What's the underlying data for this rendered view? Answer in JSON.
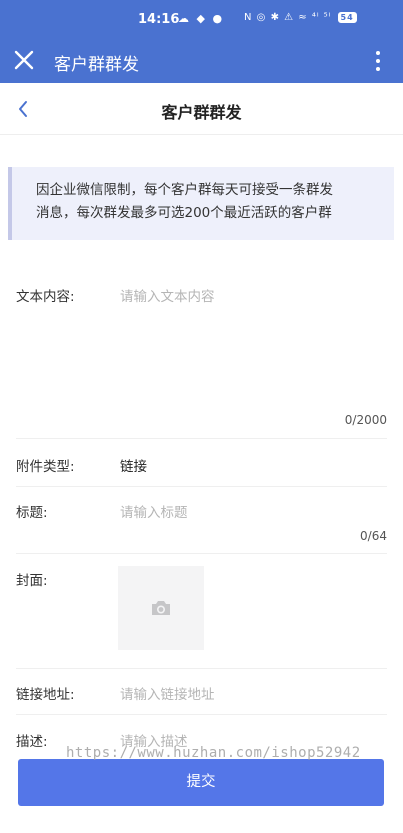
{
  "status_bar": {
    "time": "14:16",
    "left_icons": "☁ ◆ ●",
    "right_icons": "N ◎ ✱ ⚠ ≈ ⁴ˡ ⁵ˡ",
    "battery": "54"
  },
  "app_bar": {
    "title": "客户群群发"
  },
  "nav": {
    "title": "客户群群发"
  },
  "notice": {
    "line1": "因企业微信限制，每个客户群每天可接受一条群发",
    "line2": "消息，每次群发最多可选200个最近活跃的客户群"
  },
  "form": {
    "text_content": {
      "label": "文本内容:",
      "placeholder": "请输入文本内容",
      "count": "0/2000"
    },
    "attachment_type": {
      "label": "附件类型:",
      "value": "链接"
    },
    "title": {
      "label": "标题:",
      "placeholder": "请输入标题",
      "count": "0/64"
    },
    "cover": {
      "label": "封面:"
    },
    "link_url": {
      "label": "链接地址:",
      "placeholder": "请输入链接地址"
    },
    "description": {
      "label": "描述:",
      "placeholder": "请输入描述"
    }
  },
  "watermark": "https://www.huzhan.com/ishop52942",
  "submit_label": "提交",
  "colors": {
    "header_blue": "#4a72d0",
    "button_blue": "#5476e8",
    "notice_bg": "#eef0fb"
  }
}
